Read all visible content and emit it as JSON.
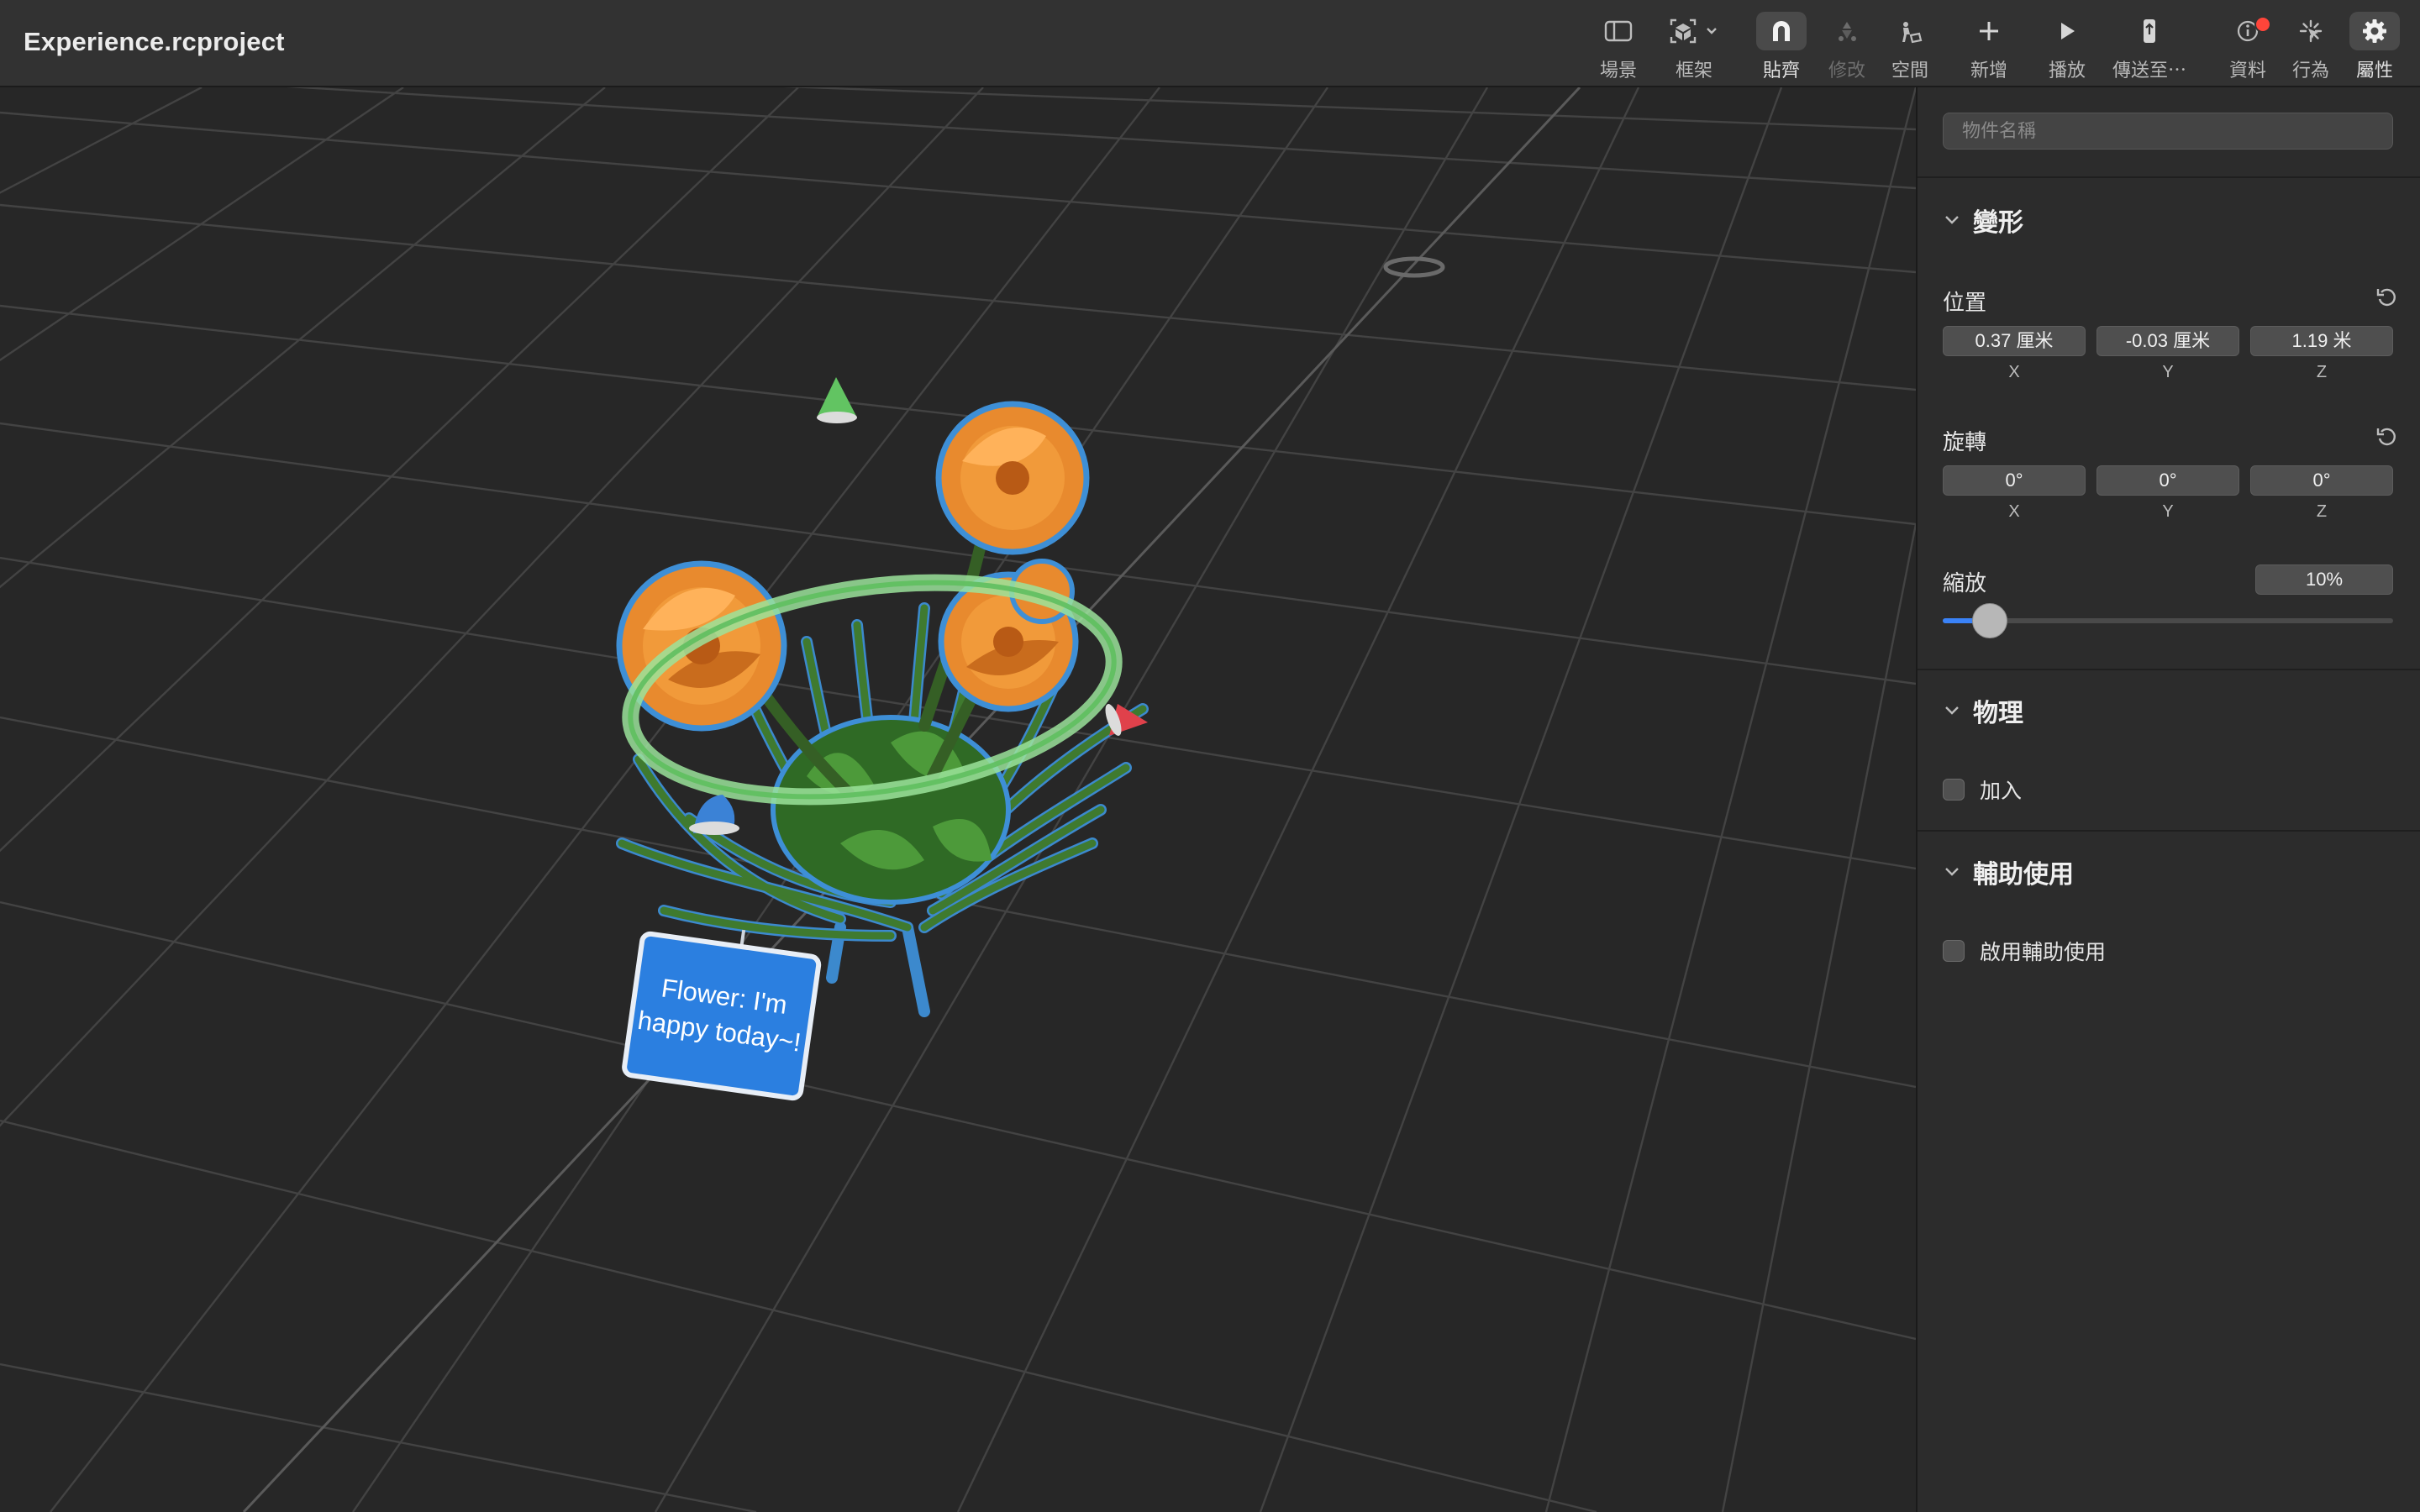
{
  "window": {
    "title": "Experience.rcproject"
  },
  "toolbar": {
    "items": [
      {
        "id": "scene",
        "label": "場景",
        "icon": "sidebar-icon"
      },
      {
        "id": "frame",
        "label": "框架",
        "icon": "frame-cube-icon"
      },
      {
        "id": "snap",
        "label": "貼齊",
        "icon": "magnet-icon",
        "active": true
      },
      {
        "id": "modify",
        "label": "修改",
        "icon": "modify-icon",
        "disabled": true
      },
      {
        "id": "space",
        "label": "空間",
        "icon": "space-icon"
      },
      {
        "id": "add",
        "label": "新增",
        "icon": "plus-icon"
      },
      {
        "id": "play",
        "label": "播放",
        "icon": "play-icon"
      },
      {
        "id": "send",
        "label": "傳送至⋯",
        "icon": "send-device-icon"
      },
      {
        "id": "info",
        "label": "資料",
        "icon": "info-icon",
        "badge": true
      },
      {
        "id": "behaviors",
        "label": "行為",
        "icon": "behaviors-icon"
      },
      {
        "id": "properties",
        "label": "屬性",
        "icon": "gear-icon",
        "active": true
      }
    ]
  },
  "viewport": {
    "sign_text_line1": "Flower: I'm",
    "sign_text_line2": "happy today~!",
    "colors": {
      "background": "#272727",
      "grid": "#444444",
      "selection_outline": "#3e8fd6",
      "rotate_ring": "#8fdc8f",
      "x_handle": "#e0414b",
      "y_handle": "#62c462",
      "z_handle": "#3b82d6",
      "petal": "#e88a2e",
      "leaf": "#3f7a2f",
      "sign": "#2b7fe0"
    }
  },
  "inspector": {
    "name_placeholder": "物件名稱",
    "name_value": "",
    "transform": {
      "title": "變形",
      "position": {
        "label": "位置",
        "x": "0.37 厘米",
        "y": "-0.03 厘米",
        "z": "1.19 米"
      },
      "rotation": {
        "label": "旋轉",
        "x": "0°",
        "y": "0°",
        "z": "0°"
      },
      "scale": {
        "label": "縮放",
        "value": "10%",
        "slider_fraction": 0.09
      },
      "axis_x": "X",
      "axis_y": "Y",
      "axis_z": "Z"
    },
    "physics": {
      "title": "物理",
      "participate_label": "加入",
      "participate_checked": false
    },
    "accessibility": {
      "title": "輔助使用",
      "enable_label": "啟用輔助使用",
      "enable_checked": false
    }
  }
}
